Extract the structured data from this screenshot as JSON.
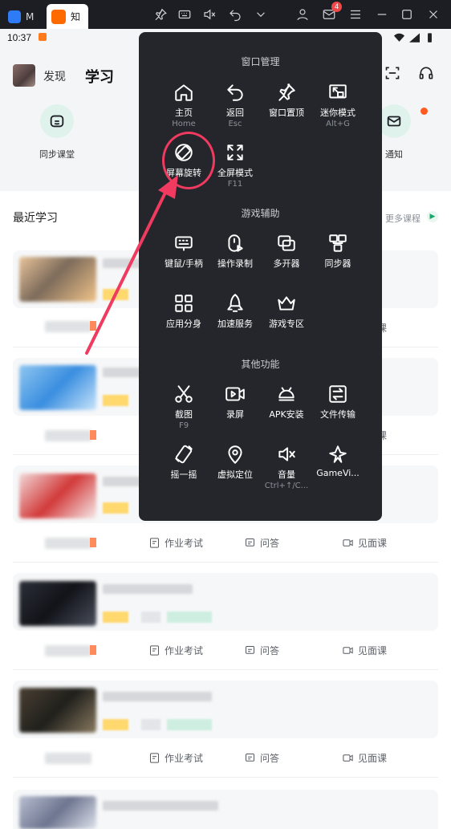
{
  "titlebar": {
    "tab1_label": "M",
    "tab2_label": "知",
    "mail_badge": "4"
  },
  "statusbar": {
    "time": "10:37"
  },
  "header": {
    "discover": "发现",
    "study": "学习"
  },
  "quick_items": [
    {
      "label": "同步课堂",
      "icon": "classroom-icon"
    },
    {
      "label": "通知",
      "icon": "mail-icon"
    }
  ],
  "recent": {
    "title": "最近学习",
    "more": "更多课程"
  },
  "actions": {
    "homework": "作业考试",
    "qa": "问答",
    "meet": "见面课"
  },
  "menu": {
    "section1": "窗口管理",
    "section2": "游戏辅助",
    "section3": "其他功能",
    "window_items": [
      {
        "label": "主页",
        "key": "Home",
        "icon": "home-icon"
      },
      {
        "label": "返回",
        "key": "Esc",
        "icon": "back-icon"
      },
      {
        "label": "窗口置顶",
        "key": "",
        "icon": "pin-icon"
      },
      {
        "label": "迷你模式",
        "key": "Alt+G",
        "icon": "mini-mode-icon"
      },
      {
        "label": "屏幕旋转",
        "key": "",
        "icon": "rotate-icon"
      },
      {
        "label": "全屏模式",
        "key": "F11",
        "icon": "fullscreen-icon"
      }
    ],
    "game_items": [
      {
        "label": "键鼠/手柄",
        "icon": "keyboard-gamepad-icon"
      },
      {
        "label": "操作录制",
        "icon": "record-macro-icon"
      },
      {
        "label": "多开器",
        "icon": "multi-instance-icon"
      },
      {
        "label": "同步器",
        "icon": "sync-icon"
      },
      {
        "label": "应用分身",
        "icon": "app-clone-icon"
      },
      {
        "label": "加速服务",
        "icon": "boost-icon"
      },
      {
        "label": "游戏专区",
        "icon": "crown-icon"
      }
    ],
    "other_items": [
      {
        "label": "截图",
        "key": "F9",
        "icon": "scissors-icon"
      },
      {
        "label": "录屏",
        "key": "",
        "icon": "screen-record-icon"
      },
      {
        "label": "APK安装",
        "key": "",
        "icon": "android-icon"
      },
      {
        "label": "文件传输",
        "key": "",
        "icon": "file-transfer-icon"
      },
      {
        "label": "摇一摇",
        "key": "",
        "icon": "shake-icon"
      },
      {
        "label": "虚拟定位",
        "key": "",
        "icon": "location-icon"
      },
      {
        "label": "音量",
        "key": "Ctrl+↑/C...",
        "icon": "volume-mute-icon"
      },
      {
        "label": "GameVi...",
        "key": "",
        "icon": "gamevi-icon"
      }
    ]
  },
  "colors": {
    "menu_bg": "#24262b",
    "highlight": "#f03a60",
    "accent_green": "#1aa86a"
  }
}
